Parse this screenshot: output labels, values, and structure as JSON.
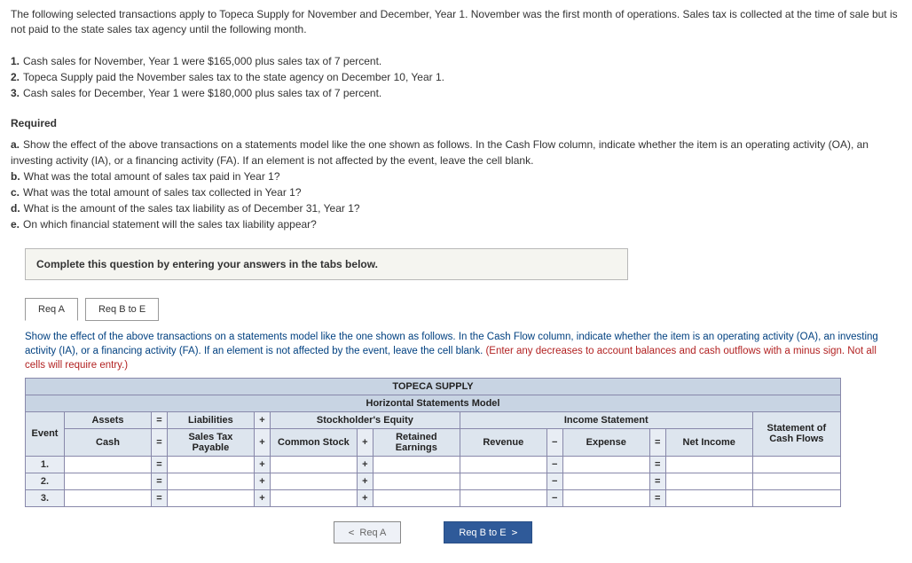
{
  "intro": "The following selected transactions apply to Topeca Supply for November and December, Year 1. November was the first month of operations. Sales tax is collected at the time of sale but is not paid to the state sales tax agency until the following month.",
  "numbered": [
    "Cash sales for November, Year 1 were $165,000 plus sales tax of 7 percent.",
    "Topeca Supply paid the November sales tax to the state agency on December 10, Year 1.",
    "Cash sales for December, Year 1 were $180,000 plus sales tax of 7 percent."
  ],
  "required_heading": "Required",
  "required": {
    "a": "Show the effect of the above transactions on a statements model like the one shown as follows. In the Cash Flow column, indicate whether the item is an operating activity (OA), an investing activity (IA), or a financing activity (FA). If an element is not affected by the event, leave the cell blank.",
    "b": "What was the total amount of sales tax paid in Year 1?",
    "c": "What was the total amount of sales tax collected in Year 1?",
    "d": "What is the amount of the sales tax liability as of December 31, Year 1?",
    "e": "On which financial statement will the sales tax liability appear?"
  },
  "complete_text": "Complete this question by entering your answers in the tabs below.",
  "tabs": {
    "a": "Req A",
    "bE": "Req B to E"
  },
  "instruction_main": "Show the effect of the above transactions on a statements model like the one shown as follows. In the Cash Flow column, indicate whether the item is an operating activity (OA), an investing activity (IA), or a financing activity (FA). If an element is not affected by the event, leave the cell blank. ",
  "instruction_red": "(Enter any decreases to account balances and cash outflows with a minus sign. Not all cells will require entry.)",
  "table": {
    "company": "TOPECA SUPPLY",
    "subtitle": "Horizontal Statements Model",
    "event": "Event",
    "assets": "Assets",
    "liabilities": "Liabilities",
    "stockholders": "Stockholder's Equity",
    "income_stmt": "Income Statement",
    "cashflows": "Statement of Cash Flows",
    "cash": "Cash",
    "salestax": "Sales Tax Payable",
    "common": "Common Stock",
    "retained": "Retained Earnings",
    "revenue": "Revenue",
    "expense": "Expense",
    "netincome": "Net Income",
    "rows": [
      "1.",
      "2.",
      "3."
    ]
  },
  "nav": {
    "prev": "Req A",
    "next": "Req B to E"
  }
}
